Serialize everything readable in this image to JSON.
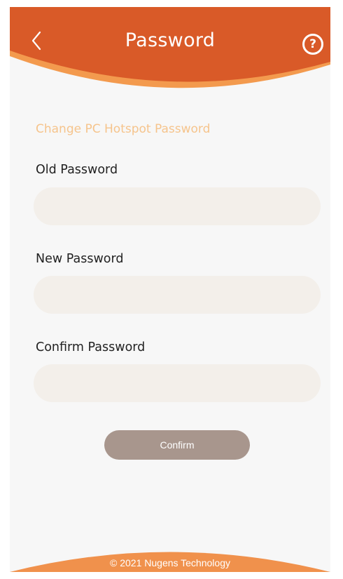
{
  "header": {
    "title": "Password",
    "back_icon": "chevron-left-icon",
    "help_icon": "question-circle-icon",
    "help_glyph": "?"
  },
  "form": {
    "section_title": "Change PC Hotspot Password",
    "fields": [
      {
        "label": "Old Password",
        "value": "",
        "placeholder": ""
      },
      {
        "label": "New Password",
        "value": "",
        "placeholder": ""
      },
      {
        "label": "Confirm Password",
        "value": "",
        "placeholder": ""
      }
    ],
    "confirm_label": "Confirm"
  },
  "footer": {
    "copyright": "© 2021 Nugens Technology"
  },
  "colors": {
    "header_primary": "#d95a28",
    "header_accent": "#f39a4e",
    "section_title": "#f6c48c",
    "input_bg": "#f3efea",
    "button_bg": "#a8968d",
    "footer_bg": "#f0914c",
    "page_bg": "#f7f7f7"
  }
}
